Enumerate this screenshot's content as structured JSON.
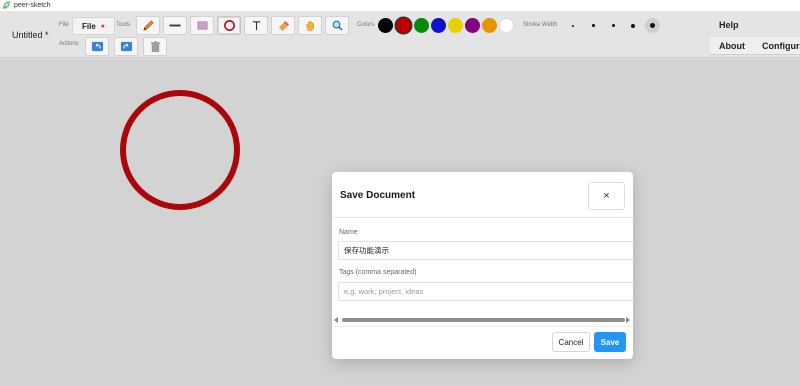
{
  "window": {
    "title": "peer-sketch"
  },
  "document": {
    "title": "Untitled *"
  },
  "toolbar": {
    "file_label": "File",
    "file_menu_label": "File",
    "tools_label": "Tools",
    "actions_label": "Actions",
    "colors_label": "Colors",
    "stroke_label": "Stroke Width",
    "help_label": "Help",
    "about_label": "About",
    "config_label": "Configurati",
    "tools": [
      {
        "name": "pencil-icon",
        "active": false
      },
      {
        "name": "line-icon",
        "active": false
      },
      {
        "name": "rectangle-icon",
        "active": false
      },
      {
        "name": "circle-icon",
        "active": true
      },
      {
        "name": "text-icon",
        "active": false
      },
      {
        "name": "eraser-icon",
        "active": false
      },
      {
        "name": "pan-hand-icon",
        "active": false
      },
      {
        "name": "zoom-icon",
        "active": false
      }
    ],
    "actions": [
      "undo-icon",
      "redo-icon",
      "trash-icon"
    ],
    "colors": [
      "#000000",
      "#c00000",
      "#0a8a0a",
      "#1010d0",
      "#e6d000",
      "#800080",
      "#e69500",
      "#ffffff"
    ],
    "selected_color": "#c00000",
    "stroke_widths": [
      1,
      2,
      3,
      4,
      5
    ],
    "selected_stroke": 5
  },
  "canvas": {
    "shape": "circle",
    "stroke_color": "#b0080a"
  },
  "dialog": {
    "title": "Save Document",
    "close_glyph": "×",
    "name_label": "Name",
    "name_value": "保存功能演示",
    "tags_label": "Tags (comma separated)",
    "tags_placeholder": "e.g. work, project, ideas",
    "cancel_label": "Cancel",
    "save_label": "Save",
    "accent": "#2196f3"
  }
}
